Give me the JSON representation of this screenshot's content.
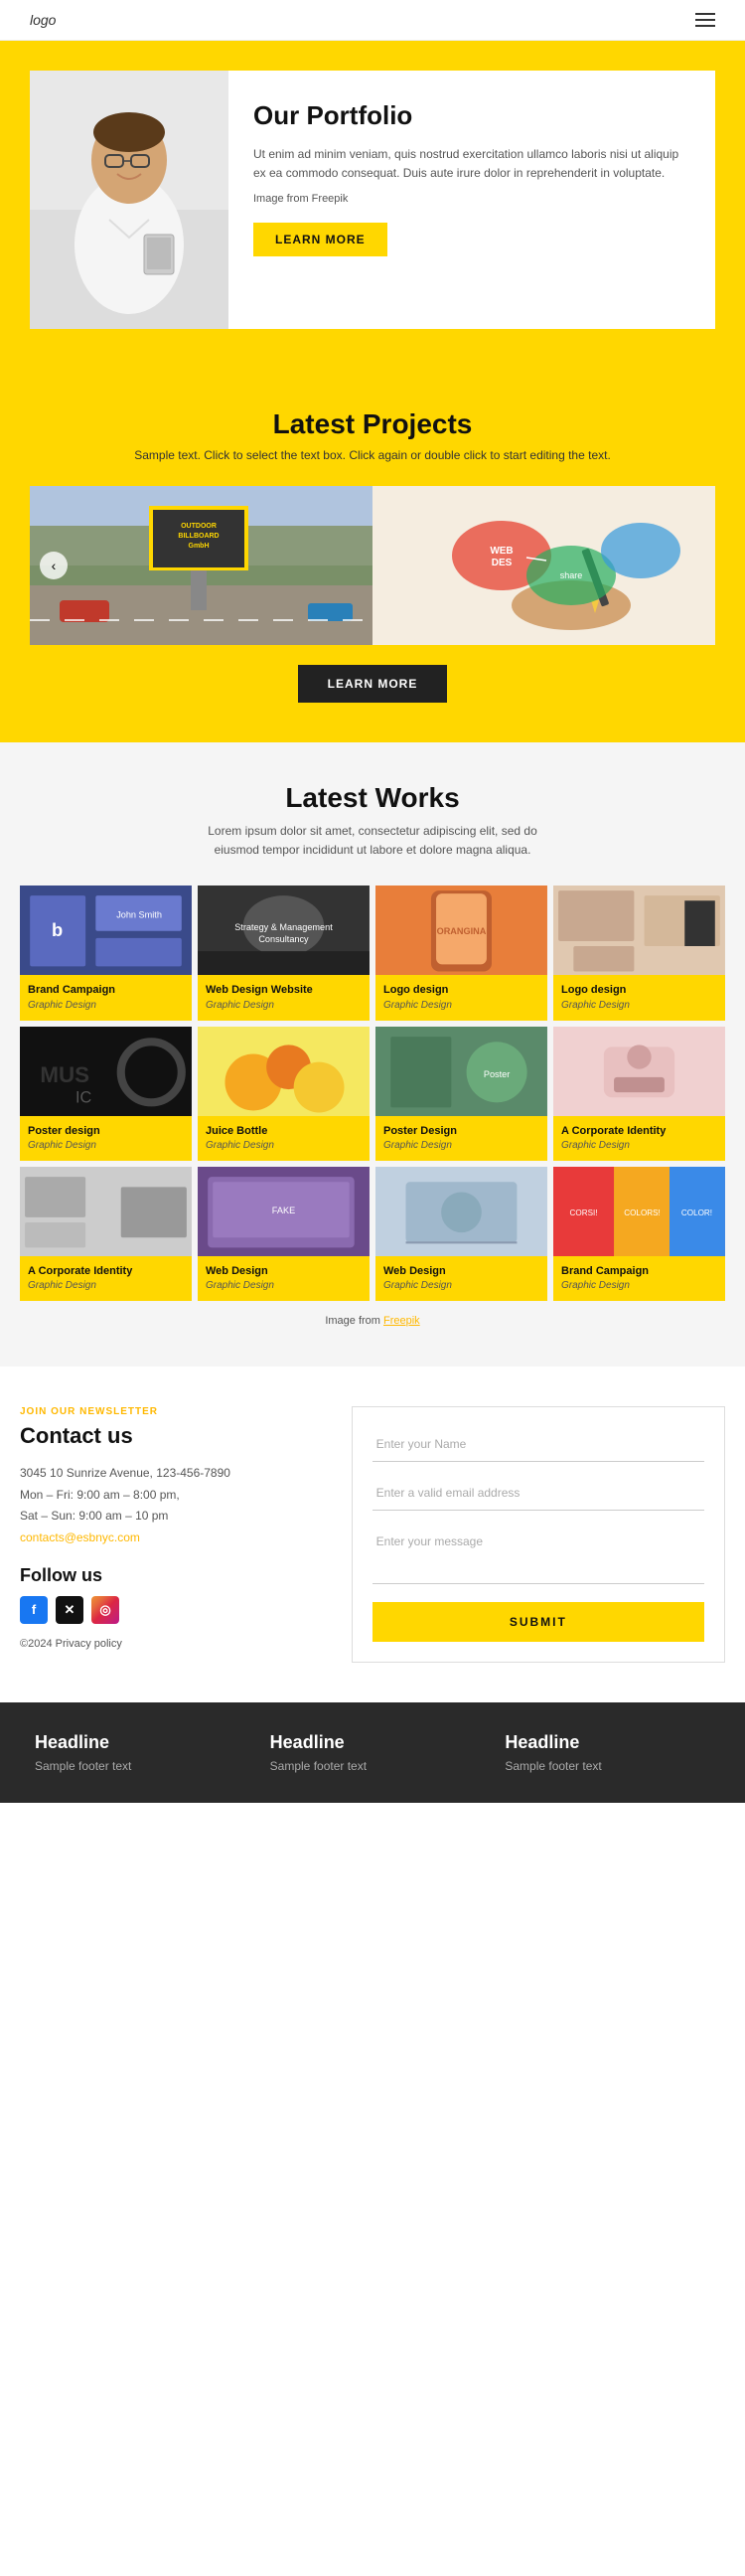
{
  "header": {
    "logo": "logo",
    "hamburger_label": "menu"
  },
  "hero": {
    "title": "Our Portfolio",
    "description": "Ut enim ad minim veniam, quis nostrud exercitation ullamco laboris nisi ut aliquip ex ea commodo consequat. Duis aute irure dolor in reprehenderit in voluptate.",
    "image_credit": "Image from Freepik",
    "cta_label": "LEARN MORE"
  },
  "latest_projects": {
    "title": "Latest Projects",
    "subtitle": "Sample text. Click to select the text box. Click again or double click to start editing the text.",
    "cta_label": "LEARN MORE"
  },
  "latest_works": {
    "title": "Latest Works",
    "subtitle": "Lorem ipsum dolor sit amet, consectetur adipiscing elit, sed do eiusmod tempor incididunt ut labore et dolore magna aliqua.",
    "credit": "Image from Freepik",
    "items": [
      {
        "title": "Brand Campaign",
        "category": "Graphic Design",
        "thumb_class": "thumb-blue"
      },
      {
        "title": "Web Design Website",
        "category": "Graphic Design",
        "thumb_class": "thumb-dark"
      },
      {
        "title": "Logo design",
        "category": "Graphic Design",
        "thumb_class": "thumb-orange"
      },
      {
        "title": "Logo design",
        "category": "Graphic Design",
        "thumb_class": "thumb-light"
      },
      {
        "title": "Poster design",
        "category": "Graphic Design",
        "thumb_class": "thumb-dark2"
      },
      {
        "title": "Juice Bottle",
        "category": "Graphic Design",
        "thumb_class": "thumb-yellow"
      },
      {
        "title": "Poster Design",
        "category": "Graphic Design",
        "thumb_class": "thumb-green"
      },
      {
        "title": "A Corporate Identity",
        "category": "Graphic Design",
        "thumb_class": "thumb-pink"
      },
      {
        "title": "A Corporate Identity",
        "category": "Graphic Design",
        "thumb_class": "thumb-gray"
      },
      {
        "title": "Web Design",
        "category": "Graphic Design",
        "thumb_class": "thumb-purple"
      },
      {
        "title": "Web Design",
        "category": "Graphic Design",
        "thumb_class": "thumb-blue2"
      },
      {
        "title": "Brand Campaign",
        "category": "Graphic Design",
        "thumb_class": "thumb-multi"
      }
    ]
  },
  "contact": {
    "label": "JOIN OUR NEWSLETTER",
    "title": "Contact us",
    "address": "3045 10 Sunrize Avenue, 123-456-7890",
    "hours1": "Mon – Fri: 9:00 am – 8:00 pm,",
    "hours2": "Sat – Sun: 9:00 am – 10 pm",
    "email": "contacts@esbnyc.com",
    "follow_title": "Follow us",
    "copyright": "©2024 Privacy policy",
    "form": {
      "name_placeholder": "Enter your Name",
      "email_placeholder": "Enter a valid email address",
      "message_placeholder": "Enter your message",
      "submit_label": "SUBMIT"
    },
    "social": [
      {
        "name": "Facebook",
        "icon": "f",
        "class": "si-fb"
      },
      {
        "name": "Twitter/X",
        "icon": "✕",
        "class": "si-tw"
      },
      {
        "name": "Instagram",
        "icon": "◎",
        "class": "si-ig"
      }
    ]
  },
  "footer": {
    "columns": [
      {
        "headline": "Headline",
        "sub": "Sample footer text"
      },
      {
        "headline": "Headline",
        "sub": "Sample footer text"
      },
      {
        "headline": "Headline",
        "sub": "Sample footer text"
      }
    ]
  }
}
